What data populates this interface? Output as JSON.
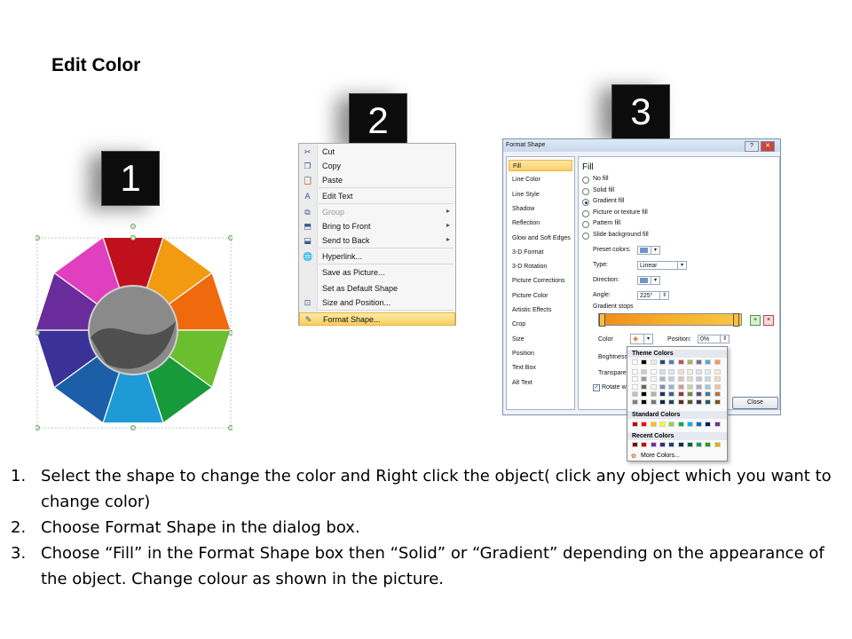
{
  "title": "Edit Color",
  "step_numbers": [
    "1",
    "2",
    "3"
  ],
  "context_menu": {
    "items": [
      {
        "label": "Cut",
        "icon": "scissors-icon",
        "glyph": "✂",
        "enabled": true,
        "submenu": false
      },
      {
        "label": "Copy",
        "icon": "copy-icon",
        "glyph": "❐",
        "enabled": true,
        "submenu": false
      },
      {
        "label": "Paste",
        "icon": "paste-icon",
        "glyph": "📋",
        "enabled": true,
        "submenu": false
      },
      {
        "label": "Edit Text",
        "icon": "edit-text-icon",
        "glyph": "A",
        "enabled": true,
        "submenu": false
      },
      {
        "label": "Group",
        "icon": "group-icon",
        "glyph": "⧉",
        "enabled": false,
        "submenu": true
      },
      {
        "label": "Bring to Front",
        "icon": "bring-front-icon",
        "glyph": "⬒",
        "enabled": true,
        "submenu": true
      },
      {
        "label": "Send to Back",
        "icon": "send-back-icon",
        "glyph": "⬓",
        "enabled": true,
        "submenu": true
      },
      {
        "label": "Hyperlink...",
        "icon": "hyperlink-icon",
        "glyph": "🌐",
        "enabled": true,
        "submenu": false
      },
      {
        "label": "Save as Picture...",
        "icon": "",
        "glyph": "",
        "enabled": true,
        "submenu": false
      },
      {
        "label": "Set as Default Shape",
        "icon": "",
        "glyph": "",
        "enabled": true,
        "submenu": false
      },
      {
        "label": "Size and Position...",
        "icon": "size-position-icon",
        "glyph": "⊡",
        "enabled": true,
        "submenu": false
      },
      {
        "label": "Format Shape...",
        "icon": "format-shape-icon",
        "glyph": "✎",
        "enabled": true,
        "submenu": false,
        "highlighted": true
      }
    ]
  },
  "format_dialog": {
    "title": "Format Shape",
    "help": "?",
    "close_x": "✕",
    "nav": [
      "Fill",
      "Line Color",
      "Line Style",
      "Shadow",
      "Reflection",
      "Glow and Soft Edges",
      "3-D Format",
      "3-D Rotation",
      "Picture Corrections",
      "Picture Color",
      "Artistic Effects",
      "Crop",
      "Size",
      "Position",
      "Text Box",
      "Alt Text"
    ],
    "section": "Fill",
    "options": [
      {
        "label": "No fill",
        "checked": false
      },
      {
        "label": "Solid fill",
        "checked": false
      },
      {
        "label": "Gradient fill",
        "checked": true
      },
      {
        "label": "Picture or texture fill",
        "checked": false
      },
      {
        "label": "Pattern fill",
        "checked": false
      },
      {
        "label": "Slide background fill",
        "checked": false
      }
    ],
    "preset_label": "Preset colors:",
    "type_label": "Type:",
    "type_value": "Linear",
    "direction_label": "Direction:",
    "angle_label": "Angle:",
    "angle_value": "225°",
    "stops_label": "Gradient stops",
    "color_label": "Color",
    "position_label": "Position:",
    "position_value": "0%",
    "brightness_label": "Brightness",
    "transparency_label": "Transpare",
    "rotate_label": "Rotate w",
    "close_label": "Close"
  },
  "palette": {
    "theme_header": "Theme Colors",
    "standard_header": "Standard Colors",
    "recent_header": "Recent Colors",
    "more": "More Colors...",
    "theme_top": [
      "#ffffff",
      "#000000",
      "#eeece1",
      "#1f497d",
      "#4f81bd",
      "#c0504d",
      "#9bbb59",
      "#8064a2",
      "#4bacc6",
      "#f79646"
    ],
    "standard": [
      "#c00000",
      "#ff0000",
      "#ffc000",
      "#ffff00",
      "#92d050",
      "#00b050",
      "#00b0f0",
      "#0070c0",
      "#002060",
      "#7030a0"
    ],
    "recent": [
      "#7b0000",
      "#c00000",
      "#7030a0",
      "#2e2e8a",
      "#1f3f7a",
      "#003050",
      "#006040",
      "#00a050",
      "#20a020",
      "#e0b000"
    ]
  },
  "instructions": [
    {
      "num": "1.",
      "text": "Select the shape to change the color and Right click the object( click any object which you want to change color)"
    },
    {
      "num": "2.",
      "text": "Choose Format Shape in the dialog box."
    },
    {
      "num": "3.",
      "text": "Choose “Fill” in the Format Shape box then “Solid” or “Gradient” depending on the appearance of the object. Change colour as shown in the picture."
    }
  ],
  "puzzle_colors": [
    "#c0101e",
    "#f29a10",
    "#ef6a0c",
    "#6bbe2e",
    "#179b3a",
    "#1e9ad6",
    "#1c5fa8",
    "#3a3296",
    "#6a2c9a",
    "#e03fbf",
    "#b21a7a"
  ]
}
